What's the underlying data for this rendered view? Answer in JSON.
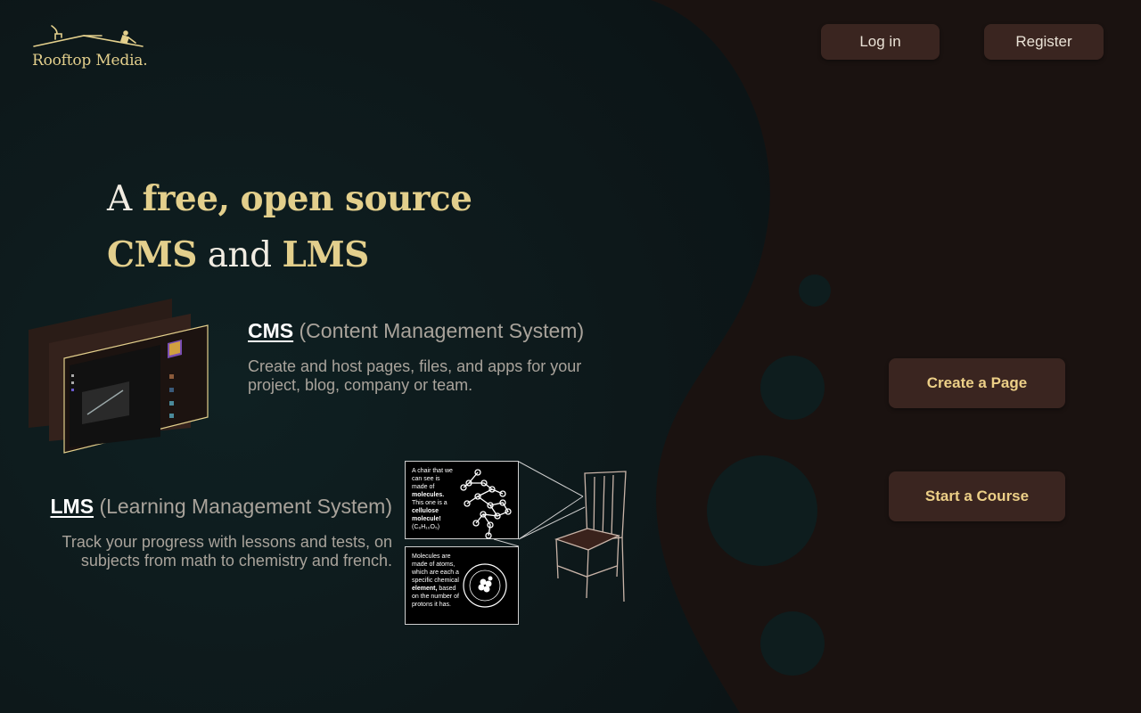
{
  "brand": {
    "name": "Rooftop Media."
  },
  "header": {
    "login_label": "Log in",
    "register_label": "Register"
  },
  "hero": {
    "headline_a": "A",
    "headline_free": "free,",
    "headline_open": "open source",
    "headline_cms": "CMS",
    "headline_and": "and",
    "headline_lms": "LMS"
  },
  "cms": {
    "abbr": "CMS",
    "full": "(Content Management System)",
    "description": "Create and host pages, files, and apps for your project, blog, company or team."
  },
  "lms": {
    "abbr": "LMS",
    "full": "(Learning Management System)",
    "description": "Track your progress with lessons and tests, on subjects from math to chemistry and french."
  },
  "lms_illustration": {
    "panel1_lines": [
      "A chair that we",
      "can see is",
      "made of"
    ],
    "panel1_bold1": "molecules.",
    "panel1_line4": "This one is a",
    "panel1_bold2": "cellulose",
    "panel1_bold3": "molecule!",
    "panel1_formula": "(C₆H₁₀O₅)",
    "panel2_lines": [
      "Molecules are",
      "made of atoms,",
      "which are each a",
      "specific chemical"
    ],
    "panel2_bold": "element,",
    "panel2_tail": [
      "based",
      "on the number of",
      "protons it has."
    ]
  },
  "actions": {
    "create_page": "Create a Page",
    "start_course": "Start a Course"
  },
  "colors": {
    "accent_gold": "#e3cf8c",
    "button_bg": "#3a2520",
    "left_bg": "#0f1a1c",
    "right_bg": "#1a1210"
  }
}
